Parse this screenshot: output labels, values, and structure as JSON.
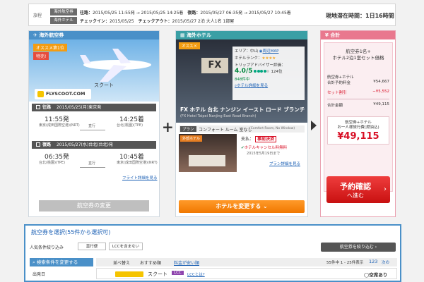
{
  "summary": {
    "label": "旅程",
    "flight_chip": "海外航空券",
    "hotel_chip": "海外ホテル",
    "flight_line_key1": "往路：",
    "flight_line_val1": "2015/05/25 11:55発 → 2015/05/25 14:25着",
    "flight_line_key2": "復路：",
    "flight_line_val2": "2015/05/27 06:35発 → 2015/05/27 10:45着",
    "hotel_line_key1": "チェックイン：",
    "hotel_line_val1": "2015/05/25",
    "hotel_line_key2": "チェックアウト：",
    "hotel_line_val2": "2015/05/27 2泊 大人1名 1部屋",
    "stay": "現地滞在時間：1日16時間"
  },
  "flight": {
    "header": "海外航空券",
    "badge": "オススメ第1位",
    "badge2": "特売!",
    "airline_name": "スクート",
    "airline_logo": "FLYSCOOT.COM",
    "outbound_title": "往路",
    "outbound_date": "2015/05/25(月)東京発",
    "outbound_dep_time": "11:55発",
    "outbound_dep_airport": "東京(成田国際空港)(NRT)",
    "outbound_direct": "直行",
    "outbound_arr_time": "14:25着",
    "outbound_arr_airport": "台北(桃園)(TPE)",
    "inbound_title": "復路",
    "inbound_date": "2015/05/27(水)台北(台北)発",
    "inbound_dep_time": "06:35発",
    "inbound_dep_airport": "台北(桃園)(TPE)",
    "inbound_direct": "直行",
    "inbound_arr_time": "10:45着",
    "inbound_arr_airport": "東京(成田国際空港)(NRT)",
    "detail_link": "フライト詳細を見る",
    "change_button": "航空券の変更"
  },
  "hotel": {
    "header": "海外ホテル",
    "badge": "オススメ",
    "area_label": "エリア：中山",
    "map_link": "周辺MAP",
    "rank_label": "ホテルランク：",
    "stars": "★★★★",
    "tripadvisor_label": "トリップアドバイザー評価：",
    "rating": "4.0/5",
    "rating_rank": "124位",
    "reviews": "848件中",
    "detail_link": "ホテル詳細を見る",
    "logo_text": "FX",
    "name": "FX ホテル 台北 ナンジン イースト ロード ブランチ",
    "name_en": "(FX Hotel Taipei Nanjing East Road Branch)",
    "plan_tag": "プラン",
    "plan_name": "コンフォート ルーム 室なし",
    "plan_name_en": "(Comfort Room, No Window)",
    "room_badge": "外部ホテル",
    "payment_label": "支払：",
    "payment_value": "事前決済",
    "cancel_free": "ホテルキャンセル料無料",
    "cancel_until": "2015年5月19日まで",
    "plan_detail_link": "プラン詳細を見る",
    "change_button": "ホテルを変更する"
  },
  "total": {
    "header": "合計",
    "title_line1": "航空券1名+",
    "title_line2": "ホテル2泊1室セット価格",
    "row1_label": "航空券+ホテル",
    "row1_label2": "合計予約料金",
    "row1_value": "¥54,667",
    "discount_label": "セット割引",
    "discount_value": "−¥5,552",
    "sum_label": "合計金額",
    "sum_value": "¥49,115",
    "per_person_label1": "航空券+ホテル",
    "per_person_label2": "お一人様旅行費(燃油込)",
    "per_person_price": "¥49,115",
    "reserve_button_line1": "予約確認",
    "reserve_button_line2": "へ進む"
  },
  "select": {
    "header": "航空券を選択(55件から選択可)",
    "filter_label": "人気条件絞り込み",
    "filter_direct": "直行便",
    "filter_no_lcc": "LCCを含まない",
    "narrow_button": "航空券を絞り込む",
    "search_header": "検索条件を変更する",
    "departure_label": "出発日",
    "sort_label": "並べ替え",
    "sort_recommended": "おすすめ順",
    "price_sort": "料金が安い順",
    "results_count": "55件中 1 - 25件表示",
    "pages": "123",
    "next": "次の",
    "row_airline": "スクート",
    "row_tag": "LCC",
    "row_link": "LCCとは?",
    "seat_status": "空席あり"
  }
}
